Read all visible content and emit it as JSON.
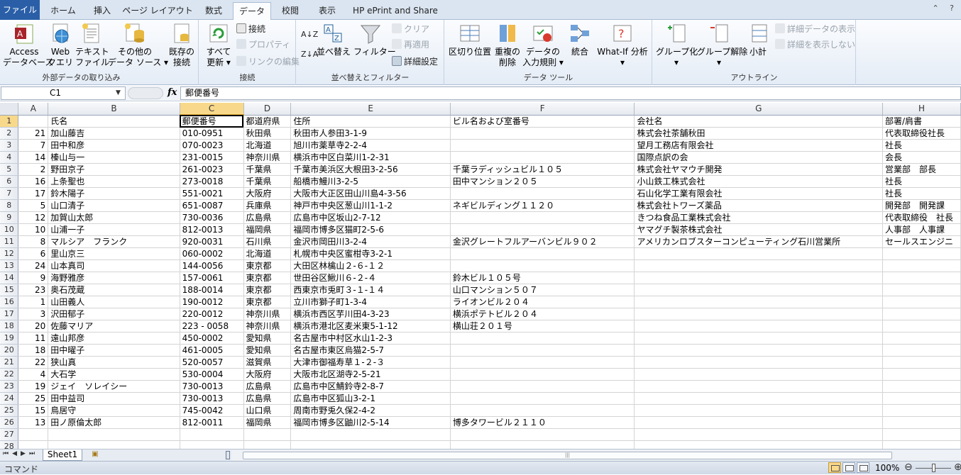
{
  "tabs": [
    "ファイル",
    "ホーム",
    "挿入",
    "ページ レイアウト",
    "数式",
    "データ",
    "校閲",
    "表示",
    "HP ePrint and Share"
  ],
  "active_tab": "データ",
  "ribbon": {
    "ext": {
      "label": "外部データの取り込み",
      "access": "Access\nデータベース",
      "web": "Web\nクエリ",
      "text": "テキスト\nファイル",
      "other": "その他の\nデータ ソース ▾",
      "existing": "既存の\n接続"
    },
    "conn": {
      "label": "接続",
      "refresh": "すべて\n更新 ▾",
      "connections": "接続",
      "properties": "プロパティ",
      "edit_links": "リンクの編集"
    },
    "sort": {
      "label": "並べ替えとフィルター",
      "sort": "並べ替え",
      "filter": "フィルター",
      "clear": "クリア",
      "reapply": "再適用",
      "advanced": "詳細設定"
    },
    "tools": {
      "label": "データ ツール",
      "text_to_columns": "区切り位置",
      "remove_dup": "重複の\n削除",
      "validation": "データの\n入力規則 ▾",
      "consolidate": "統合",
      "whatif": "What-If 分析\n▾"
    },
    "outline": {
      "label": "アウトライン",
      "group": "グループ化\n▾",
      "ungroup": "グループ解除\n▾",
      "subtotal": "小計",
      "show_detail": "詳細データの表示",
      "hide_detail": "詳細を表示しない"
    }
  },
  "formula_bar": {
    "name_box": "C1",
    "fx": "fx",
    "value": "郵便番号"
  },
  "columns": [
    "A",
    "B",
    "C",
    "D",
    "E",
    "F",
    "G",
    "H"
  ],
  "selected_column": "C",
  "rows": [
    [
      "",
      "氏名",
      "郵便番号",
      "都道府県",
      "住所",
      "ビル名および室番号",
      "会社名",
      "部署/肩書"
    ],
    [
      "21",
      "加山藤吉",
      "010-0951",
      "秋田県",
      "秋田市人参田3-1-9",
      "",
      "株式会社茶舗秋田",
      "代表取締役社長"
    ],
    [
      "7",
      "田中和彦",
      "070-0023",
      "北海道",
      "旭川市薬草寺2-2-4",
      "",
      "望月工務店有限会社",
      "社長"
    ],
    [
      "14",
      "榛山与一",
      "231-0015",
      "神奈川県",
      "横浜市中区白菜川1-2-31",
      "",
      "国際点訳の会",
      "会長"
    ],
    [
      "2",
      "野田京子",
      "261-0023",
      "千葉県",
      "千葉市美浜区大根田3-2-56",
      "千葉ラディッシュビル１０５",
      "株式会社ヤマウチ開発",
      "営業部　部長"
    ],
    [
      "16",
      "上条聖也",
      "273-0018",
      "千葉県",
      "船橋市鰻川3-2-5",
      "田中マンション２０５",
      "小山鉄工株式会社",
      "社長"
    ],
    [
      "17",
      "鈴木陽子",
      "551-0021",
      "大阪府",
      "大阪市大正区田山川島4-3-56",
      "",
      "石山化学工業有限会社",
      "社長"
    ],
    [
      "5",
      "山口清子",
      "651-0087",
      "兵庫県",
      "神戸市中央区葱山川1-1-2",
      "ネギビルディング１１２０",
      "株式会社トワーズ薬品",
      "開発部　開発課"
    ],
    [
      "12",
      "加賀山太郎",
      "730-0036",
      "広島県",
      "広島市中区坂山2-7-12",
      "",
      "きつね食品工業株式会社",
      "代表取締役　社長"
    ],
    [
      "10",
      "山浦一子",
      "812-0013",
      "福岡県",
      "福岡市博多区猫町2-5-6",
      "",
      "ヤマグチ製茶株式会社",
      "人事部　人事課"
    ],
    [
      "8",
      "マルシア　フランク",
      "920-0031",
      "石川県",
      "金沢市岡田川3-2-4",
      "金沢グレートフルアーバンビル９０２",
      "アメリカンロブスターコンピューティング石川営業所",
      "セールスエンジニ"
    ],
    [
      "6",
      "里山京三",
      "060-0002",
      "北海道",
      "札幌市中央区蜜柑寺3-2-1",
      "",
      "",
      ""
    ],
    [
      "24",
      "山本真司",
      "144-0056",
      "東京都",
      "大田区林檎山２-６-１２",
      "",
      "",
      ""
    ],
    [
      "9",
      "海野雅彦",
      "157-0061",
      "東京都",
      "世田谷区鰍川６-２-４",
      "鈴木ビル１０５号",
      "",
      ""
    ],
    [
      "23",
      "奥石茂蔵",
      "188-0014",
      "東京都",
      "西東京市兎町３-１-１４",
      "山口マンション５０７",
      "",
      ""
    ],
    [
      "1",
      "山田義人",
      "190-0012",
      "東京都",
      "立川市獅子町1-3-4",
      "ライオンビル２０４",
      "",
      ""
    ],
    [
      "3",
      "沢田郁子",
      "220-0012",
      "神奈川県",
      "横浜市西区芋川田4-3-23",
      "横浜ポテトビル２０４",
      "",
      ""
    ],
    [
      "20",
      "佐藤マリア",
      "223 - 0058",
      "神奈川県",
      "横浜市港北区麦米東5-1-12",
      "横山荘２０１号",
      "",
      ""
    ],
    [
      "11",
      "遠山邦彦",
      "450-0002",
      "愛知県",
      "名古屋市中村区水山1-2-3",
      "",
      "",
      ""
    ],
    [
      "18",
      "田中曜子",
      "461-0005",
      "愛知県",
      "名古屋市東区烏猫2-5-7",
      "",
      "",
      ""
    ],
    [
      "22",
      "狭山真",
      "520-0057",
      "滋賀県",
      "大津市御福寿草１-２-３",
      "",
      "",
      ""
    ],
    [
      "4",
      "大石学",
      "530-0004",
      "大阪府",
      "大阪市北区湖寺2-5-21",
      "",
      "",
      ""
    ],
    [
      "19",
      "ジェイ　ソレイシー",
      "730-0013",
      "広島県",
      "広島市中区鯖鈴寺2-8-7",
      "",
      "",
      ""
    ],
    [
      "25",
      "田中益司",
      "730-0013",
      "広島県",
      "広島市中区狐山3-2-1",
      "",
      "",
      ""
    ],
    [
      "15",
      "鳥居守",
      "745-0042",
      "山口県",
      "周南市野兎久保2-4-2",
      "",
      "",
      ""
    ],
    [
      "13",
      "田ノ原倫太郎",
      "812-0011",
      "福岡県",
      "福岡市博多区鼬川2-5-14",
      "博多タワービル２１１０",
      "",
      ""
    ],
    [
      "",
      "",
      "",
      "",
      "",
      "",
      "",
      ""
    ],
    [
      "",
      "",
      "",
      "",
      "",
      "",
      "",
      ""
    ]
  ],
  "sheet_tab": "Sheet1",
  "status": {
    "mode": "コマンド",
    "zoom": "100%"
  }
}
